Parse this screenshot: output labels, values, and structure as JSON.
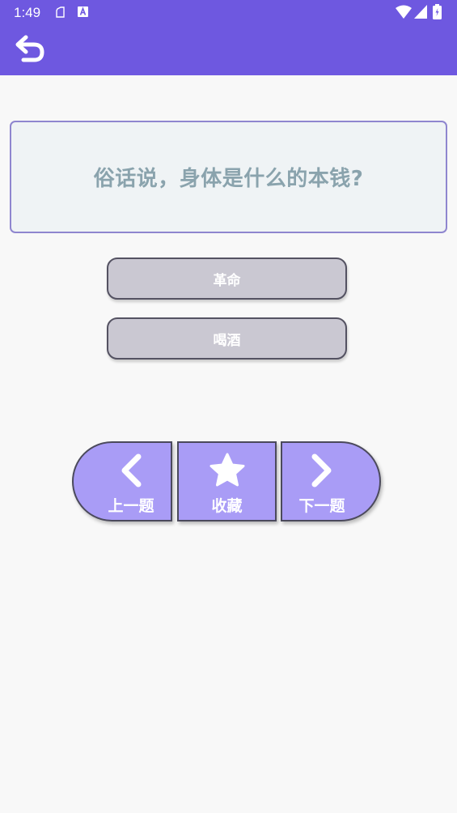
{
  "status_bar": {
    "time": "1:49",
    "icons": [
      "clipboard-icon",
      "font-a-icon",
      "wifi-icon",
      "signal-icon",
      "battery-icon"
    ]
  },
  "app_bar": {
    "back_icon": "back-arrow-icon",
    "color": "#6e58e0"
  },
  "question": {
    "text": "俗话说，身体是什么的本钱?"
  },
  "options": [
    {
      "label": "革命"
    },
    {
      "label": "喝酒"
    }
  ],
  "nav": {
    "prev_label": "上一题",
    "favorite_label": "收藏",
    "next_label": "下一题",
    "button_color": "#a99cf6"
  }
}
